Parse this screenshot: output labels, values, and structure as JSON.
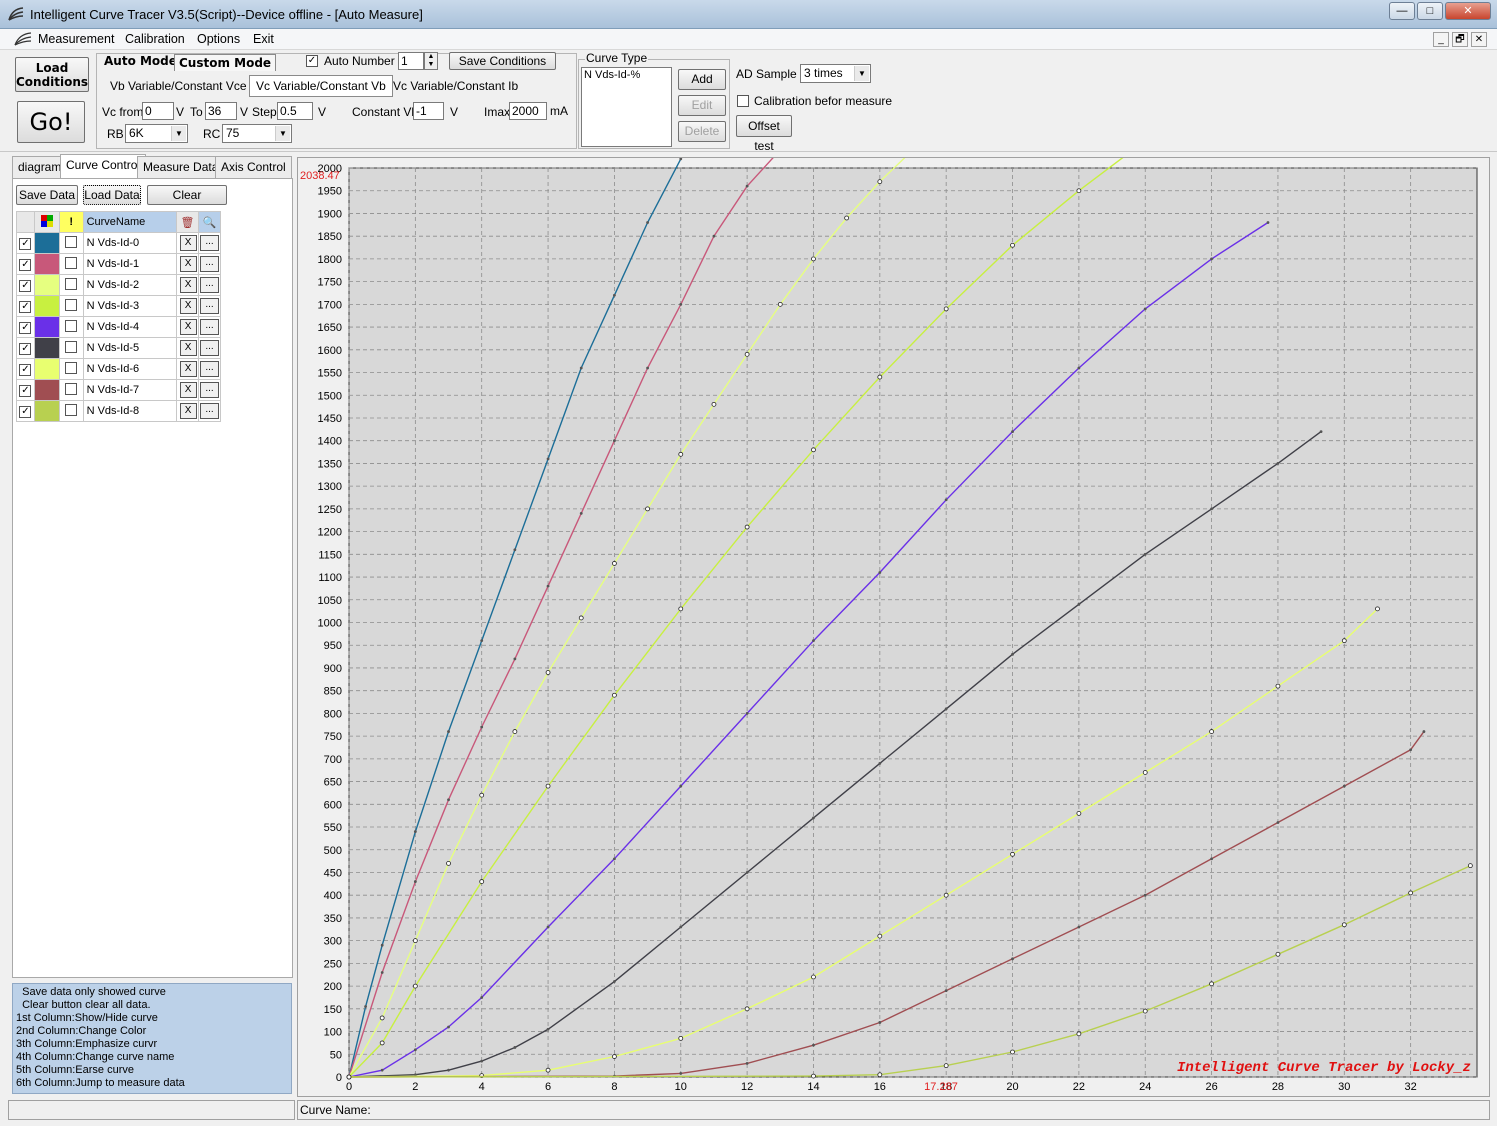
{
  "window": {
    "title": "Intelligent Curve Tracer V3.5(Script)--Device offline - [Auto Measure]",
    "min_label": "—",
    "max_label": "□",
    "close_label": "✕"
  },
  "menu": {
    "items": [
      {
        "label": "Measurement"
      },
      {
        "label": "Calibration"
      },
      {
        "label": "Options"
      },
      {
        "label": "Exit"
      }
    ],
    "mdi_min": "_",
    "mdi_restore": "🗗",
    "mdi_close": "✕"
  },
  "toolbar": {
    "load_conditions_line1": "Load",
    "load_conditions_line2": "Conditions",
    "go_label": "Go!",
    "auto_mode": "Auto Mode",
    "custom_mode": "Custom Mode",
    "auto_number_label": "Auto Number",
    "auto_number_checked": true,
    "auto_number_value": "1",
    "save_conditions": "Save Conditions",
    "sub_tabs": [
      {
        "label": "Vb Variable/Constant Vce",
        "active": false
      },
      {
        "label": "Vc Variable/Constant Vb",
        "active": true
      },
      {
        "label": "Vc Variable/Constant Ib",
        "active": false
      }
    ],
    "vc_from_label": "Vc from",
    "vc_from_value": "0",
    "v_unit": "V",
    "to_label": "To",
    "to_value": "36",
    "step_label": "Step",
    "step_value": "0.5",
    "constant_vb_label": "Constant Vb",
    "constant_vb_value": "-1",
    "imax_label": "Imax",
    "imax_value": "2000",
    "ma_unit": "mA",
    "rb_label": "RB",
    "rb_value": "6K",
    "rc_label": "RC",
    "rc_value": "75"
  },
  "curve_type": {
    "group_label": "Curve Type",
    "list_items": [
      "N Vds-Id-%"
    ],
    "add": "Add",
    "edit": "Edit",
    "delete": "Delete"
  },
  "ad_sample": {
    "label": "AD Sample",
    "value": "3 times",
    "calibration_label": "Calibration befor measure",
    "calibration_checked": false,
    "offset_test": "Offset test"
  },
  "left_tabs": [
    {
      "label": "diagram",
      "active": false
    },
    {
      "label": "Curve Control",
      "active": true
    },
    {
      "label": "Measure Data",
      "active": false
    },
    {
      "label": "Axis Control",
      "active": false
    }
  ],
  "curve_control": {
    "save_data": "Save Data",
    "load_data": "Load Data",
    "clear": "Clear",
    "header_name": "CurveName",
    "delete_label": "X",
    "jump_label": "...",
    "curves": [
      {
        "name": "N Vds-Id-0",
        "color": "#1c6e98",
        "show": true,
        "emph": false
      },
      {
        "name": "N Vds-Id-1",
        "color": "#c8587a",
        "show": true,
        "emph": false
      },
      {
        "name": "N Vds-Id-2",
        "color": "#e6ff80",
        "show": true,
        "emph": false
      },
      {
        "name": "N Vds-Id-3",
        "color": "#c8f040",
        "show": true,
        "emph": false
      },
      {
        "name": "N Vds-Id-4",
        "color": "#6a30e8",
        "show": true,
        "emph": false
      },
      {
        "name": "N Vds-Id-5",
        "color": "#404048",
        "show": true,
        "emph": false
      },
      {
        "name": "N Vds-Id-6",
        "color": "#e8ff70",
        "show": true,
        "emph": false
      },
      {
        "name": "N Vds-Id-7",
        "color": "#a04e52",
        "show": true,
        "emph": false
      },
      {
        "name": "N Vds-Id-8",
        "color": "#b8d050",
        "show": true,
        "emph": false
      }
    ],
    "help_lines": [
      "  Save data only showed curve",
      "  Clear button clear all data.",
      "1st Column:Show/Hide curve",
      "2nd Column:Change Color",
      "3th Column:Emphasize curvr",
      "4th Column:Change curve name",
      "5th Column:Earse curve",
      "6th Column:Jump to measure data"
    ]
  },
  "status_bar": {
    "left": "",
    "curve_name_label": "Curve Name:"
  },
  "chart_data": {
    "type": "line",
    "xlim": [
      0,
      34
    ],
    "ylim": [
      0,
      2000
    ],
    "x_ticks": [
      0,
      2,
      4,
      6,
      8,
      10,
      12,
      14,
      16,
      18,
      20,
      22,
      24,
      26,
      28,
      30,
      32
    ],
    "y_ticks": [
      0,
      50,
      100,
      150,
      200,
      250,
      300,
      350,
      400,
      450,
      500,
      550,
      600,
      650,
      700,
      750,
      800,
      850,
      900,
      950,
      1000,
      1050,
      1100,
      1150,
      1200,
      1250,
      1300,
      1350,
      1400,
      1450,
      1500,
      1550,
      1600,
      1650,
      1700,
      1750,
      1800,
      1850,
      1900,
      1950,
      2000
    ],
    "grid": true,
    "y_max_marker": "2038.47",
    "x_marker": "17.287",
    "watermark": "Intelligent Curve Tracer by Locky_z",
    "series": [
      {
        "name": "N Vds-Id-0",
        "color": "#1c6e98",
        "marker": "dot",
        "x": [
          0,
          0.5,
          1,
          2,
          3,
          4,
          5,
          6,
          7,
          8,
          9,
          10,
          10.3
        ],
        "y": [
          0,
          155,
          290,
          540,
          760,
          960,
          1160,
          1360,
          1560,
          1720,
          1880,
          2020,
          2060
        ]
      },
      {
        "name": "N Vds-Id-1",
        "color": "#c8587a",
        "marker": "dot",
        "x": [
          0,
          1,
          2,
          3,
          4,
          5,
          6,
          7,
          8,
          9,
          10,
          11,
          12,
          13,
          13.3
        ],
        "y": [
          0,
          230,
          430,
          610,
          770,
          920,
          1080,
          1240,
          1400,
          1560,
          1700,
          1850,
          1960,
          2040,
          2060
        ]
      },
      {
        "name": "N Vds-Id-2",
        "color": "#e6ff80",
        "marker": "circle",
        "x": [
          0,
          1,
          2,
          3,
          4,
          5,
          6,
          7,
          8,
          9,
          10,
          11,
          12,
          13,
          14,
          15,
          16,
          17,
          17.8
        ],
        "y": [
          0,
          130,
          300,
          470,
          620,
          760,
          890,
          1010,
          1130,
          1250,
          1370,
          1480,
          1590,
          1700,
          1800,
          1890,
          1970,
          2040,
          2060
        ]
      },
      {
        "name": "N Vds-Id-3",
        "color": "#c8f040",
        "marker": "circle",
        "x": [
          0,
          1,
          2,
          4,
          6,
          8,
          10,
          12,
          14,
          16,
          18,
          20,
          22,
          24
        ],
        "y": [
          0,
          75,
          200,
          430,
          640,
          840,
          1030,
          1210,
          1380,
          1540,
          1690,
          1830,
          1950,
          2060
        ]
      },
      {
        "name": "N Vds-Id-4",
        "color": "#6a30e8",
        "marker": "dot",
        "x": [
          0,
          1,
          2,
          3,
          4,
          6,
          8,
          10,
          12,
          14,
          16,
          18,
          20,
          22,
          24,
          26,
          27.7
        ],
        "y": [
          0,
          15,
          60,
          110,
          175,
          330,
          480,
          640,
          800,
          960,
          1110,
          1270,
          1420,
          1560,
          1690,
          1800,
          1880
        ]
      },
      {
        "name": "N Vds-Id-5",
        "color": "#404048",
        "marker": "dot",
        "x": [
          0,
          2,
          3,
          4,
          5,
          6,
          8,
          10,
          12,
          14,
          16,
          18,
          20,
          22,
          24,
          26,
          28,
          29.3
        ],
        "y": [
          0,
          5,
          15,
          35,
          65,
          105,
          210,
          330,
          450,
          570,
          690,
          810,
          930,
          1040,
          1150,
          1250,
          1350,
          1420
        ]
      },
      {
        "name": "N Vds-Id-6",
        "color": "#e8ff70",
        "marker": "circle",
        "x": [
          0,
          4,
          6,
          8,
          10,
          12,
          14,
          16,
          18,
          20,
          22,
          24,
          26,
          28,
          30,
          31
        ],
        "y": [
          0,
          3,
          15,
          45,
          85,
          150,
          220,
          310,
          400,
          490,
          580,
          670,
          760,
          860,
          960,
          1030
        ]
      },
      {
        "name": "N Vds-Id-7",
        "color": "#a04e52",
        "marker": "dot",
        "x": [
          0,
          8,
          10,
          12,
          14,
          16,
          18,
          20,
          22,
          24,
          26,
          28,
          30,
          32,
          32.4
        ],
        "y": [
          0,
          2,
          8,
          30,
          70,
          120,
          190,
          260,
          330,
          400,
          480,
          560,
          640,
          720,
          760
        ]
      },
      {
        "name": "N Vds-Id-8",
        "color": "#b8d050",
        "marker": "circle",
        "x": [
          0,
          14,
          16,
          18,
          20,
          22,
          24,
          26,
          28,
          30,
          32,
          33.8
        ],
        "y": [
          0,
          2,
          5,
          25,
          55,
          95,
          145,
          205,
          270,
          335,
          405,
          465
        ]
      }
    ]
  }
}
